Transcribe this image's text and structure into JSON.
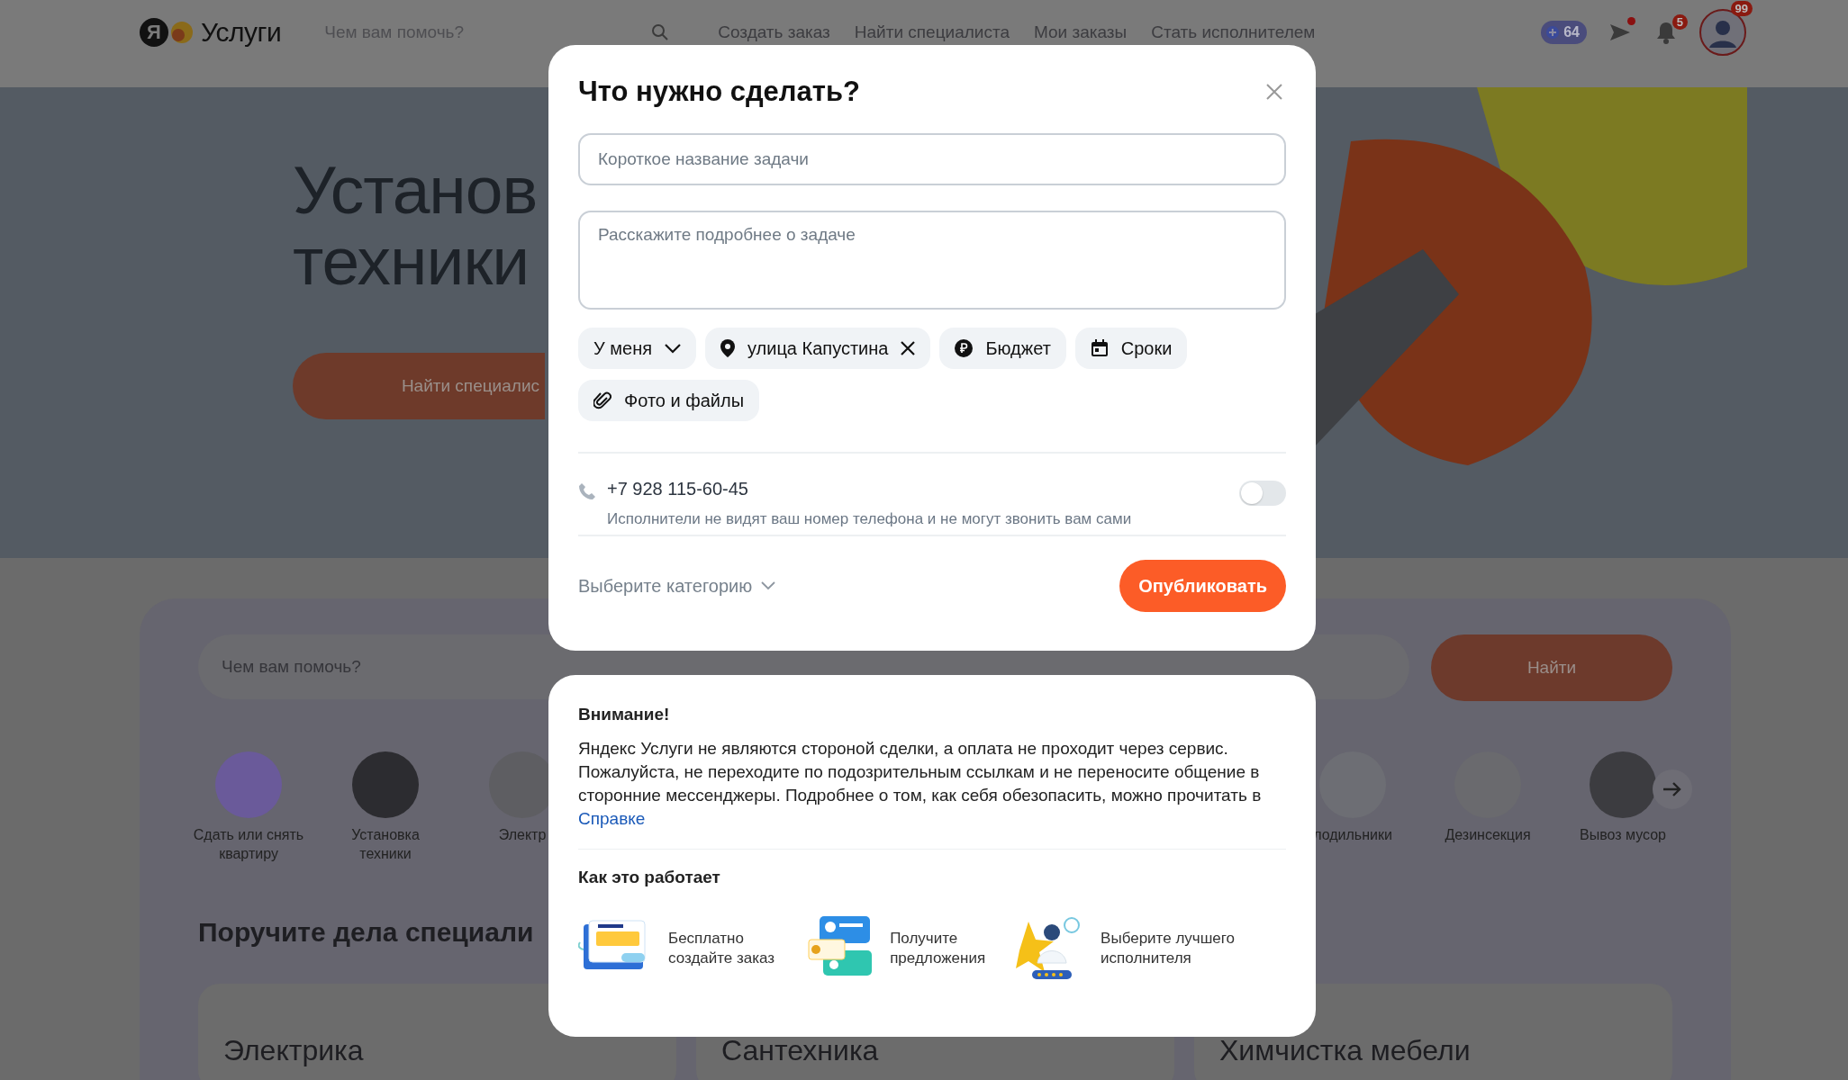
{
  "header": {
    "logo_mark": "Я",
    "logo_text": "Услуги",
    "search": {
      "placeholder": "Чем вам помочь?"
    },
    "nav": [
      "Создать заказ",
      "Найти специалиста",
      "Мои заказы",
      "Стать исполнителем"
    ],
    "plus_count": "64",
    "messages_unread": true,
    "notifications": "5",
    "avatar_badge": "99"
  },
  "hero": {
    "title_lines": [
      "Установ",
      "техники"
    ],
    "button": "Найти специалис"
  },
  "services": {
    "search": {
      "placeholder": "Чем вам помочь?"
    },
    "button": "Найти",
    "categories_left": [
      {
        "kind": "flat",
        "lines": [
          "Сдать или снять",
          "квартиру"
        ]
      },
      {
        "kind": "appliance",
        "lines": [
          "Установка",
          "техники"
        ]
      },
      {
        "kind": "electric",
        "lines": [
          "Электр"
        ]
      }
    ],
    "categories_right": [
      {
        "kind": "fridge",
        "lines": [
          "лодильники"
        ]
      },
      {
        "kind": "sprayer",
        "lines": [
          "Дезинсекция"
        ]
      },
      {
        "kind": "trash",
        "lines": [
          "Вывоз мусор"
        ]
      }
    ],
    "heading": "Поручите дела специали",
    "cards": [
      "Электрика",
      "Сантехника",
      "Химчистка мебели"
    ]
  },
  "dialog": {
    "title": "Что нужно сделать?",
    "fields": [
      {
        "kind": "input",
        "placeholder": "Короткое название задачи"
      },
      {
        "kind": "textarea",
        "placeholder": "Расскажите подробнее о задаче"
      }
    ],
    "chips": [
      {
        "kind": "dropdown",
        "label": "У меня",
        "removable": false
      },
      {
        "kind": "address",
        "label": "улица Капустина",
        "removable": true
      },
      {
        "kind": "budget",
        "label": "Бюджет",
        "removable": false
      },
      {
        "kind": "deadline",
        "label": "Сроки",
        "removable": false
      },
      {
        "kind": "attachment",
        "label": "Фото и файлы",
        "removable": false
      }
    ],
    "phone": {
      "number": "+7 928 115-60-45",
      "note": "Исполнители не видят ваш номер телефона и не могут звонить вам сами",
      "on": false
    },
    "category": "Выберите категорию",
    "submit": "Опубликовать"
  },
  "notice": {
    "title": "Внимание!",
    "text": "Яндекс Услуги не являются стороной сделки, а оплата не проходит через сервис. Пожалуйста, не переходите по подозрительным ссылкам и не переносите общение в сторонние мессенджеры. Подробнее о том, как себя обезопасить, можно прочитать в ",
    "link": "Справке",
    "how_title": "Как это работает",
    "steps": [
      {
        "kind": "create",
        "lines": [
          "Бесплатно",
          "создайте заказ"
        ]
      },
      {
        "kind": "offers",
        "lines": [
          "Получите",
          "предложения"
        ]
      },
      {
        "kind": "choose",
        "lines": [
          "Выберите лучшего",
          "исполнителя"
        ]
      }
    ]
  }
}
